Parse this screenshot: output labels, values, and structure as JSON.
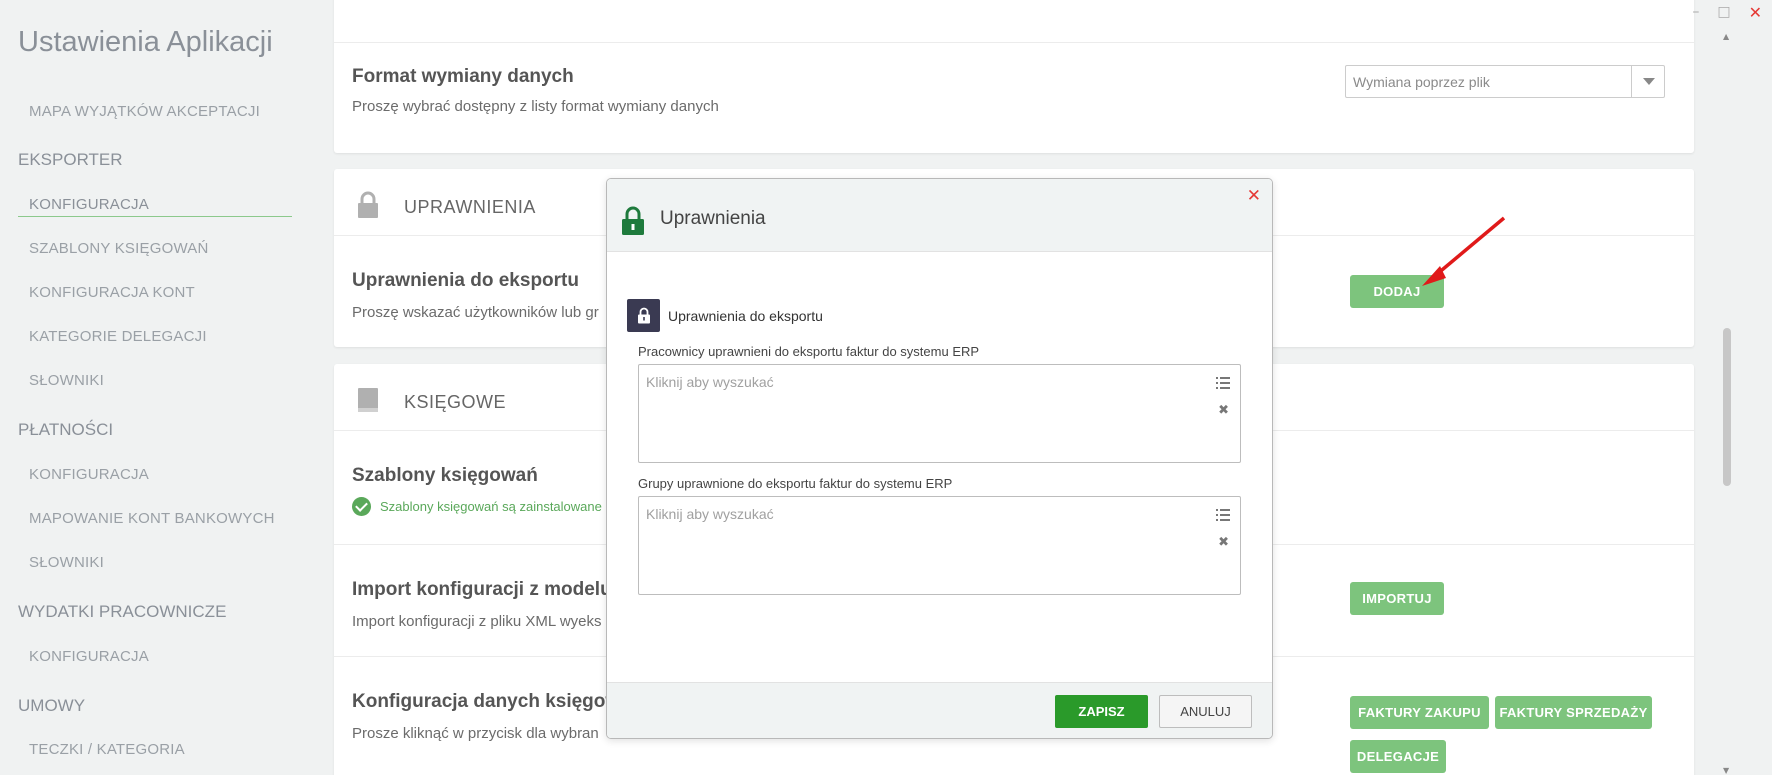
{
  "window": {
    "minimize": "–",
    "maximize": "□",
    "close": "✕"
  },
  "sidebar": {
    "title": "Ustawienia Aplikacji",
    "items": [
      {
        "kind": "item",
        "label": "MAPA WYJĄTKÓW AKCEPTACJI"
      },
      {
        "kind": "section",
        "label": "EKSPORTER"
      },
      {
        "kind": "item",
        "label": "KONFIGURACJA",
        "active": true
      },
      {
        "kind": "item",
        "label": "SZABLONY KSIĘGOWAŃ"
      },
      {
        "kind": "item",
        "label": "KONFIGURACJA KONT"
      },
      {
        "kind": "item",
        "label": "KATEGORIE DELEGACJI"
      },
      {
        "kind": "item",
        "label": "SŁOWNIKI"
      },
      {
        "kind": "section",
        "label": "PŁATNOŚCI"
      },
      {
        "kind": "item",
        "label": "KONFIGURACJA"
      },
      {
        "kind": "item",
        "label": "MAPOWANIE KONT BANKOWYCH"
      },
      {
        "kind": "item",
        "label": "SŁOWNIKI"
      },
      {
        "kind": "section",
        "label": "WYDATKI PRACOWNICZE"
      },
      {
        "kind": "item",
        "label": "KONFIGURACJA"
      },
      {
        "kind": "section",
        "label": "UMOWY"
      },
      {
        "kind": "item",
        "label": "TECZKI / KATEGORIA"
      }
    ]
  },
  "format_card": {
    "title": "Format wymiany danych",
    "desc": "Proszę wybrać dostępny z listy format wymiany danych",
    "select_value": "Wymiana poprzez plik"
  },
  "permissions_card": {
    "header": "UPRAWNIENIA",
    "title": "Uprawnienia do eksportu",
    "desc": "Proszę wskazać użytkowników lub gr",
    "add_button": "DODAJ"
  },
  "accounting_card": {
    "header": "KSIĘGOWE",
    "templates_title": "Szablony księgowań",
    "templates_status": "Szablony księgowań są zainstalowane",
    "import_title": "Import konfiguracji z modelu",
    "import_desc": "Import konfiguracji z pliku XML wyeks",
    "import_button": "IMPORTUJ",
    "config_title": "Konfiguracja danych księgow",
    "config_desc": "Prosze kliknąć w przycisk dla wybran",
    "buttons": {
      "purchase": "FAKTURY ZAKUPU",
      "sales": "FAKTURY SPRZEDAŻY",
      "delegations": "DELEGACJE"
    }
  },
  "modal": {
    "title": "Uprawnienia",
    "close": "✕",
    "section_title": "Uprawnienia do eksportu",
    "field1": {
      "label": "Pracownicy uprawnieni do eksportu faktur do systemu ERP",
      "placeholder": "Kliknij aby wyszukać"
    },
    "field2": {
      "label": "Grupy uprawnione do eksportu faktur do systemu ERP",
      "placeholder": "Kliknij aby wyszukać"
    },
    "clear": "✖",
    "save": "ZAPISZ",
    "cancel": "ANULUJ"
  },
  "colors": {
    "accent_green": "#7dc47d",
    "save_green": "#2a9a2a",
    "arrow_red": "#e01a1a",
    "close_red": "#e53935"
  }
}
